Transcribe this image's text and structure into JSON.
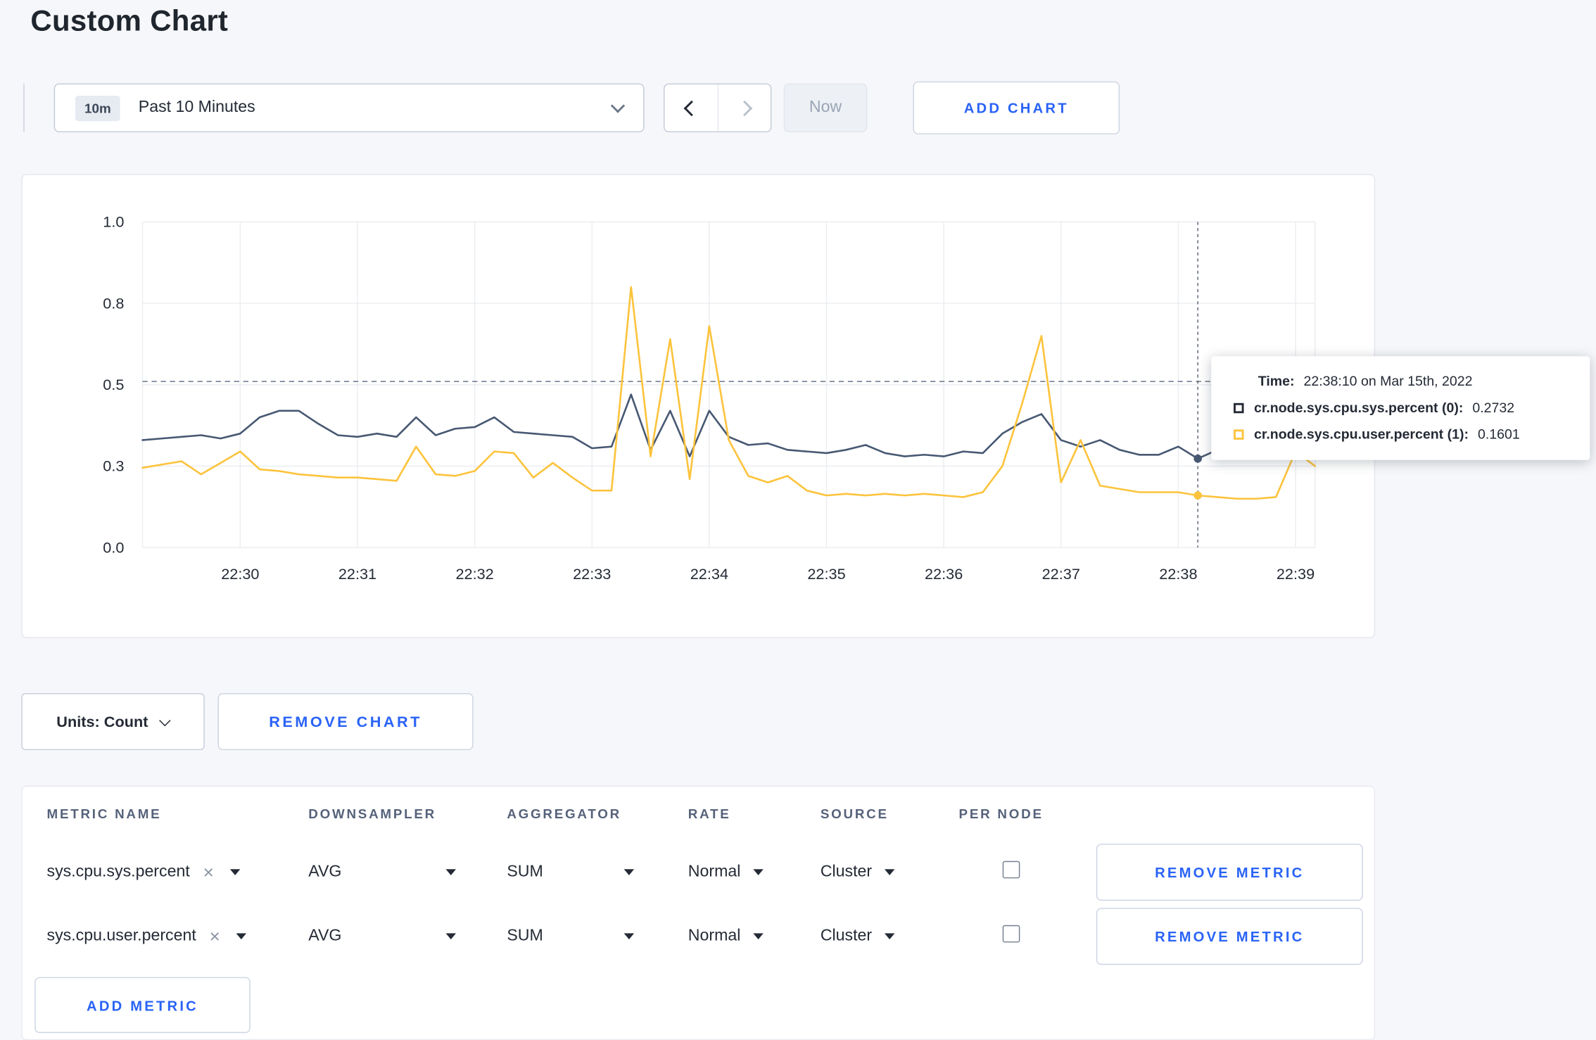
{
  "page": {
    "title": "Custom Chart",
    "background": "#f6f7fa"
  },
  "colors": {
    "accent_blue": "#2a63f6",
    "series_sys": "#475872",
    "series_user": "#fcc33c",
    "text_dark": "#242a35"
  },
  "icons": {
    "time_range": "chevron-down-icon",
    "prev": "chevron-left-icon",
    "next": "chevron-right-icon",
    "units": "chevron-down-icon",
    "metric_clear": "x-icon",
    "dropdown": "caret-down-icon"
  },
  "toolbar": {
    "time_badge": "10m",
    "time_label": "Past 10 Minutes",
    "now_label": "Now",
    "add_chart_label": "ADD CHART"
  },
  "chart_data": {
    "type": "line",
    "title": "",
    "xlabel": "",
    "ylabel": "",
    "ylim": [
      0,
      1
    ],
    "grid": true,
    "start_time": "22:29:10",
    "sample_interval_seconds": 10,
    "guideline_value": 0.51,
    "crosshair_index": 54,
    "crosshair_time": "22:38:10",
    "y_ticks": [
      {
        "label": "0.0",
        "value": 0
      },
      {
        "label": "0.3",
        "value": 0.25
      },
      {
        "label": "0.5",
        "value": 0.5
      },
      {
        "label": "0.8",
        "value": 0.75
      },
      {
        "label": "1.0",
        "value": 1
      }
    ],
    "x_ticks": [
      {
        "label": "22:30",
        "index": 5
      },
      {
        "label": "22:31",
        "index": 11
      },
      {
        "label": "22:32",
        "index": 17
      },
      {
        "label": "22:33",
        "index": 23
      },
      {
        "label": "22:34",
        "index": 29
      },
      {
        "label": "22:35",
        "index": 35
      },
      {
        "label": "22:36",
        "index": 41
      },
      {
        "label": "22:37",
        "index": 47
      },
      {
        "label": "22:38",
        "index": 53
      },
      {
        "label": "22:39",
        "index": 59
      }
    ],
    "series": [
      {
        "name": "cr.node.sys.cpu.sys.percent",
        "color": "#475872",
        "values": [
          0.33,
          0.335,
          0.34,
          0.345,
          0.335,
          0.35,
          0.4,
          0.42,
          0.42,
          0.38,
          0.345,
          0.34,
          0.35,
          0.34,
          0.4,
          0.345,
          0.365,
          0.37,
          0.4,
          0.355,
          0.35,
          0.345,
          0.34,
          0.305,
          0.31,
          0.47,
          0.3,
          0.42,
          0.28,
          0.42,
          0.34,
          0.315,
          0.32,
          0.3,
          0.295,
          0.29,
          0.3,
          0.315,
          0.29,
          0.28,
          0.285,
          0.28,
          0.295,
          0.29,
          0.35,
          0.385,
          0.41,
          0.33,
          0.31,
          0.33,
          0.3,
          0.285,
          0.285,
          0.31,
          0.2732,
          0.3,
          0.295,
          0.3,
          0.295,
          0.3,
          0.295
        ]
      },
      {
        "name": "cr.node.sys.cpu.user.percent",
        "color": "#fcc33c",
        "values": [
          0.245,
          0.255,
          0.265,
          0.225,
          0.26,
          0.295,
          0.24,
          0.235,
          0.225,
          0.22,
          0.215,
          0.215,
          0.21,
          0.205,
          0.31,
          0.225,
          0.22,
          0.235,
          0.295,
          0.29,
          0.215,
          0.26,
          0.215,
          0.175,
          0.175,
          0.8,
          0.28,
          0.64,
          0.21,
          0.68,
          0.33,
          0.22,
          0.2,
          0.22,
          0.175,
          0.16,
          0.165,
          0.16,
          0.165,
          0.16,
          0.165,
          0.16,
          0.155,
          0.17,
          0.25,
          0.44,
          0.65,
          0.2,
          0.33,
          0.19,
          0.18,
          0.17,
          0.17,
          0.17,
          0.1601,
          0.155,
          0.15,
          0.15,
          0.155,
          0.295,
          0.25
        ]
      }
    ]
  },
  "tooltip": {
    "time_label": "Time:",
    "time_value": "22:38:10 on Mar 15th, 2022",
    "series": [
      {
        "label": "cr.node.sys.cpu.sys.percent (0):",
        "value": "0.2732",
        "color": "#242a35"
      },
      {
        "label": "cr.node.sys.cpu.user.percent (1):",
        "value": "0.1601",
        "color": "#fcc33c"
      }
    ]
  },
  "chart_controls": {
    "units_label": "Units: Count",
    "remove_chart_label": "REMOVE CHART"
  },
  "metrics_table": {
    "headers": [
      "METRIC NAME",
      "DOWNSAMPLER",
      "AGGREGATOR",
      "RATE",
      "SOURCE",
      "PER NODE"
    ],
    "rows": [
      {
        "metric": "sys.cpu.sys.percent",
        "downsampler": "AVG",
        "aggregator": "SUM",
        "rate": "Normal",
        "source": "Cluster",
        "per_node": false,
        "remove_label": "REMOVE METRIC"
      },
      {
        "metric": "sys.cpu.user.percent",
        "downsampler": "AVG",
        "aggregator": "SUM",
        "rate": "Normal",
        "source": "Cluster",
        "per_node": false,
        "remove_label": "REMOVE METRIC"
      }
    ],
    "add_metric_label": "ADD METRIC"
  }
}
